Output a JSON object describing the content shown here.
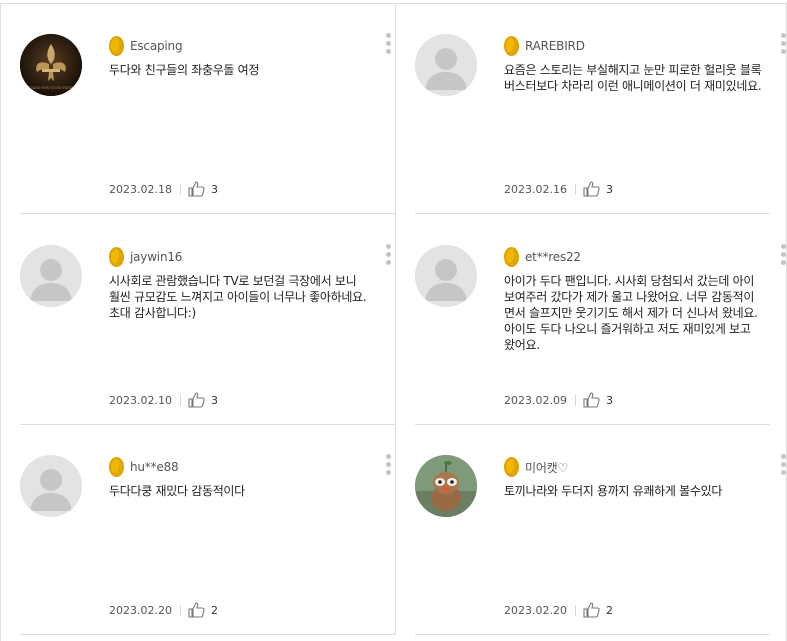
{
  "reviews": [
    {
      "username": "Escaping",
      "text": "두다와 친구들의 좌충우돌 여정",
      "date": "2023.02.18",
      "likes": "3",
      "avatar": "fleur-de-lis-photo",
      "avatar_caption": "STAND FOR YOURS FAITH"
    },
    {
      "username": "RAREBIRD",
      "text": "요즘은 스토리는 부실해지고 눈만 피로한 헐리웃 블록버스터보다 차라리 이런 애니메이션이 더 재미있네요.",
      "date": "2023.02.16",
      "likes": "3",
      "avatar": "default-avatar"
    },
    {
      "username": "jaywin16",
      "text": "시사회로 관람했습니다 TV로 보던걸 극장에서 보니 훨씬 규모감도 느껴지고 아이들이 너무나 좋아하네요. 초대 감사합니다:)",
      "date": "2023.02.10",
      "likes": "3",
      "avatar": "default-avatar"
    },
    {
      "username": "et**res22",
      "text": "아이가 두다 팬입니다. 시사회 당첨되서 갔는데 아이 보여주러 갔다가 제가 울고 나왔어요. 너무 감동적이면서 슬프지만 웃기기도 해서 제가 더 신나서 왔네요. 아이도 두다 나오니 즐거워하고 저도 재미있게 보고 왔어요.",
      "date": "2023.02.09",
      "likes": "3",
      "avatar": "default-avatar"
    },
    {
      "username": "hu**e88",
      "text": "두다다쿵 재밌다 감동적이다",
      "date": "2023.02.20",
      "likes": "2",
      "avatar": "default-avatar"
    },
    {
      "username": "미어캣♡",
      "text": "토끼나라와 두더지 용까지 유쾌하게 볼수있다",
      "date": "2023.02.20",
      "likes": "2",
      "avatar": "plush-toy-photo"
    }
  ],
  "icons": {
    "badge": "gold-egg-badge-icon",
    "more": "more-vertical-icon",
    "like": "thumbs-up-icon"
  },
  "colors": {
    "badge": "#f2b705",
    "divider": "#dedede",
    "text": "#222222",
    "meta": "#555555"
  }
}
